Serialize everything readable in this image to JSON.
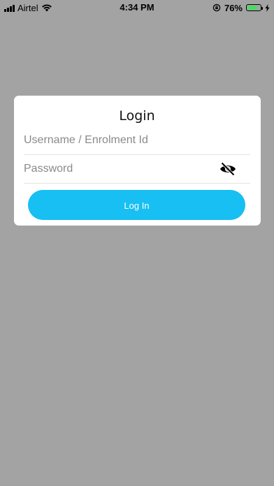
{
  "status_bar": {
    "carrier": "Airtel",
    "time": "4:34 PM",
    "battery_percent": "76%",
    "battery_level": 0.76,
    "battery_color": "#4cd964"
  },
  "login": {
    "title": "Login",
    "username_placeholder": "Username / Enrolment Id",
    "password_placeholder": "Password",
    "password_toggle_icon": "eye-off-icon",
    "login_button_label": "Log In",
    "button_color": "#17bff2"
  },
  "background_color": "#a3a3a3"
}
